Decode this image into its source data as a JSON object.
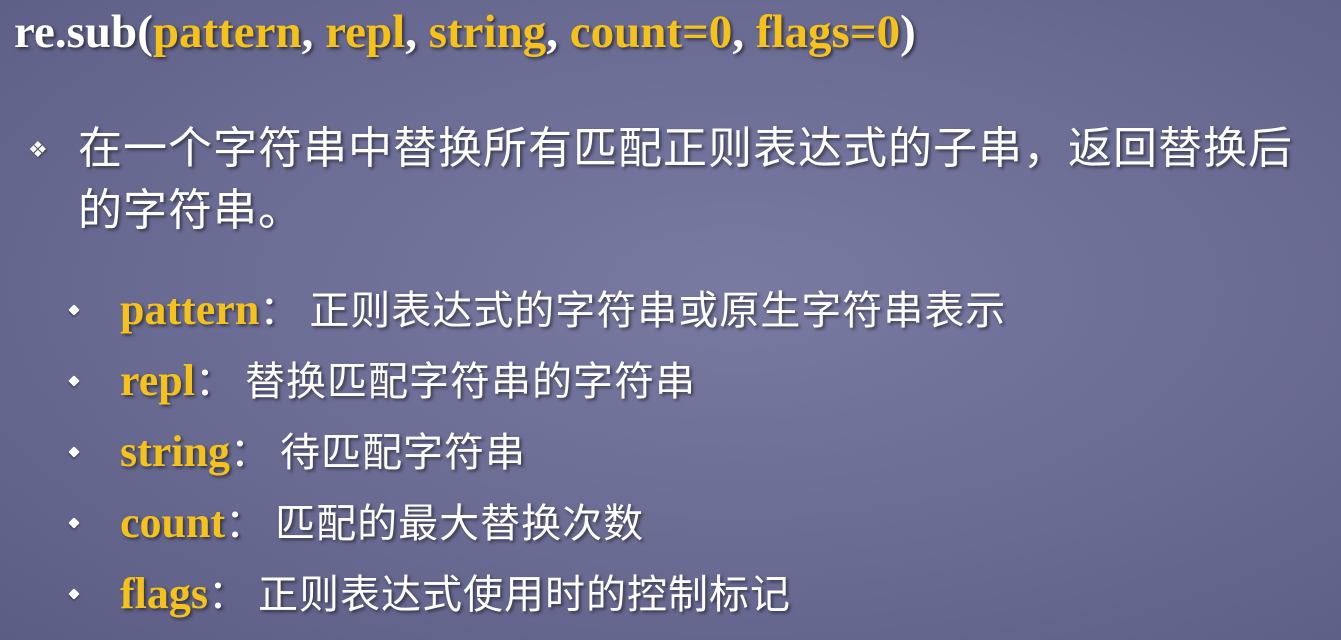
{
  "title": {
    "func": "re.sub(",
    "arg1": "pattern",
    "sep1": ", ",
    "arg2": "repl",
    "sep2": ", ",
    "arg3": "string",
    "sep3": ", ",
    "arg4": "count=0",
    "sep4": ", ",
    "arg5": "flags=0",
    "close": ")"
  },
  "main_bullet": {
    "icon": "diamond-bullet-icon",
    "text": "在一个字符串中替换所有匹配正则表达式的子串，返回替换后的字符串。"
  },
  "params": [
    {
      "name": "pattern",
      "colon": "：",
      "desc": "正则表达式的字符串或原生字符串表示"
    },
    {
      "name": "repl",
      "colon": "：",
      "desc": "替换匹配字符串的字符串"
    },
    {
      "name": "string",
      "colon": "：",
      "desc": "待匹配字符串"
    },
    {
      "name": "count",
      "colon": "：",
      "desc": "匹配的最大替换次数"
    },
    {
      "name": "flags",
      "colon": "：",
      "desc": "正则表达式使用时的控制标记"
    }
  ],
  "colors": {
    "background": "#6b6b94",
    "highlight": "#f4c21a",
    "text": "#ffffff"
  }
}
